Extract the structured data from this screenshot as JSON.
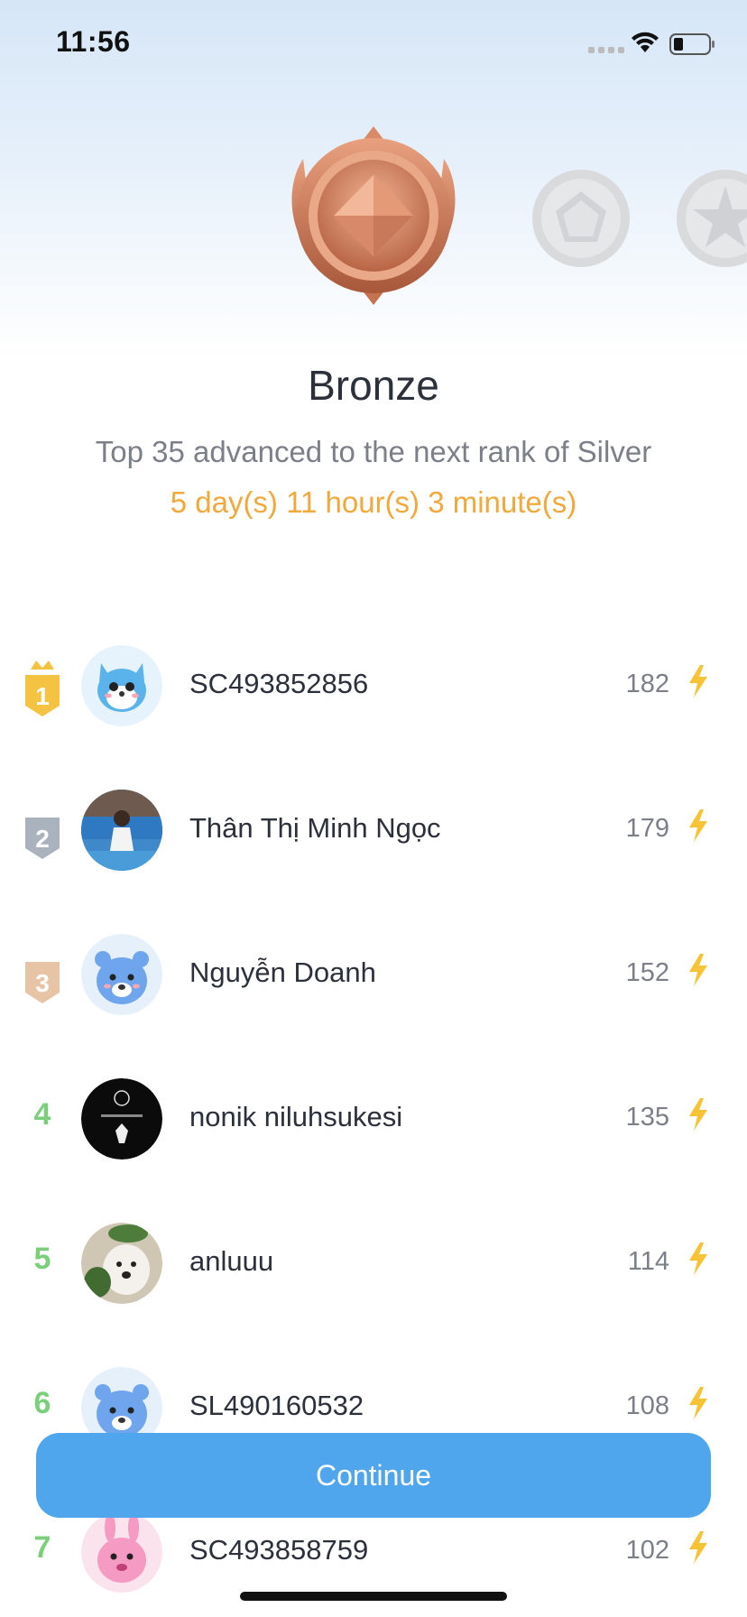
{
  "status_bar": {
    "time": "11:56"
  },
  "rank": {
    "title": "Bronze",
    "subtitle": "Top 35 advanced to the next rank of Silver",
    "timer": "5 day(s) 11 hour(s) 3 minute(s)"
  },
  "leaderboard": [
    {
      "rank": "1",
      "name": "SC493852856",
      "score": "182",
      "badge": "gold-crown-badge",
      "avatar": "blue-fox-avatar"
    },
    {
      "rank": "2",
      "name": "Thân Thị Minh Ngọc",
      "score": "179",
      "badge": "silver-badge",
      "avatar": "photo-avatar"
    },
    {
      "rank": "3",
      "name": "Nguyễn Doanh",
      "score": "152",
      "badge": "bronze-badge",
      "avatar": "blue-bear-avatar"
    },
    {
      "rank": "4",
      "name": "nonik niluhsukesi",
      "score": "135",
      "badge": "",
      "avatar": "dark-photo-avatar"
    },
    {
      "rank": "5",
      "name": "anluuu",
      "score": "114",
      "badge": "",
      "avatar": "dog-photo-avatar"
    },
    {
      "rank": "6",
      "name": "SL490160532",
      "score": "108",
      "badge": "",
      "avatar": "blue-bear-avatar"
    },
    {
      "rank": "7",
      "name": "SC493858759",
      "score": "102",
      "badge": "",
      "avatar": "pink-bunny-avatar"
    }
  ],
  "continue_label": "Continue",
  "colors": {
    "accent_blue": "#4fa6ec",
    "timer_orange": "#f2a83a",
    "rank_green": "#7ccf7a",
    "bolt_yellow": "#f7c234",
    "bronze": "#c8795a"
  },
  "icons": [
    "wifi-icon",
    "battery-icon",
    "bronze-medal-icon",
    "silver-medal-icon",
    "lightning-bolt-icon"
  ]
}
